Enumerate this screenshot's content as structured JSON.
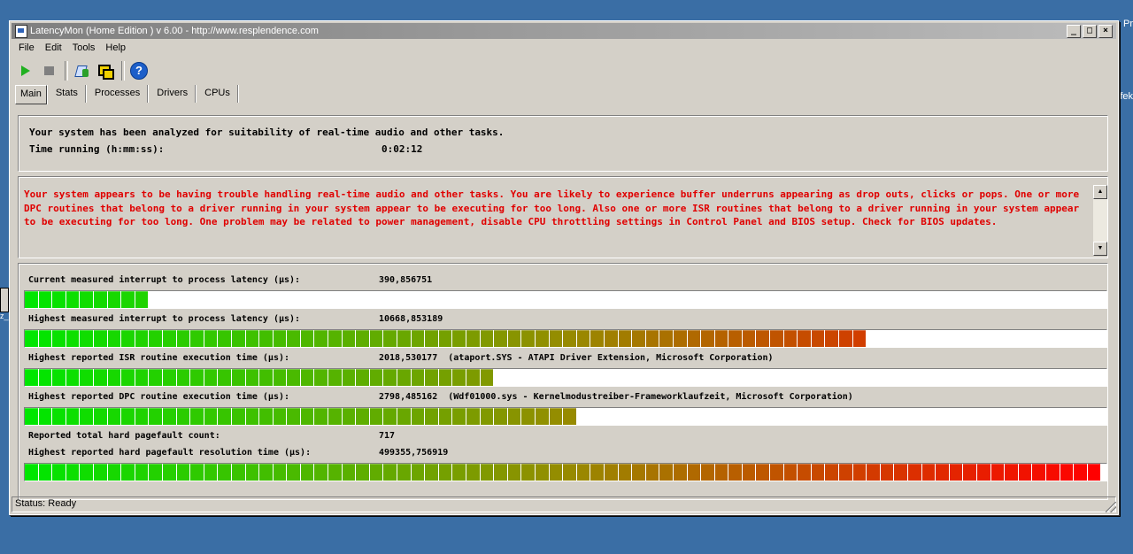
{
  "window": {
    "title": "LatencyMon  (Home Edition )  v 6.00 - http://www.resplendence.com"
  },
  "desktop": {
    "text1": "Pr",
    "text2": "fek",
    "text3": "z_"
  },
  "titlebar_buttons": {
    "minimize": "_",
    "maximize": "□",
    "close": "×"
  },
  "menu": {
    "file": "File",
    "edit": "Edit",
    "tools": "Tools",
    "help": "Help"
  },
  "toolbar": {
    "help_glyph": "?"
  },
  "tabs": {
    "main": "Main",
    "stats": "Stats",
    "processes": "Processes",
    "drivers": "Drivers",
    "cpus": "CPUs"
  },
  "summary": {
    "line1": "Your system has been analyzed for suitability of real-time audio and other tasks.",
    "time_label": "Time running (h:mm:ss):",
    "time_value": "0:02:12"
  },
  "message": {
    "text": "Your system appears to be having trouble handling real-time audio and other tasks. You are likely to experience buffer underruns appearing as drop outs, clicks or pops. One or more DPC routines that belong to a driver running in your system appear to be executing for too long. Also one or more ISR routines that belong to a driver running in your system appear to be executing for too long. One problem may be related to power management, disable CPU throttling settings in Control Panel and BIOS setup. Check for BIOS updates."
  },
  "metrics": [
    {
      "label": "Current measured interrupt to process latency (µs):",
      "value": "390,856751",
      "level": 0.11
    },
    {
      "label": "Highest measured interrupt to process latency (µs):",
      "value": "10668,853189",
      "level": 0.78
    },
    {
      "label": "Highest reported ISR routine execution time (µs):",
      "value": "2018,530177  (ataport.SYS - ATAPI Driver Extension, Microsoft Corporation)",
      "level": 0.43
    },
    {
      "label": "Highest reported DPC routine execution time (µs):",
      "value": "2798,485162  (Wdf01000.sys - Kernelmodustreiber-Frameworklaufzeit, Microsoft Corporation)",
      "level": 0.51
    },
    {
      "label": "Reported total hard pagefault count:",
      "value": "717"
    },
    {
      "label": "Highest reported hard pagefault resolution time (µs):",
      "value": "499355,756919",
      "level": 1.0
    }
  ],
  "status": {
    "text": "Status: Ready"
  }
}
